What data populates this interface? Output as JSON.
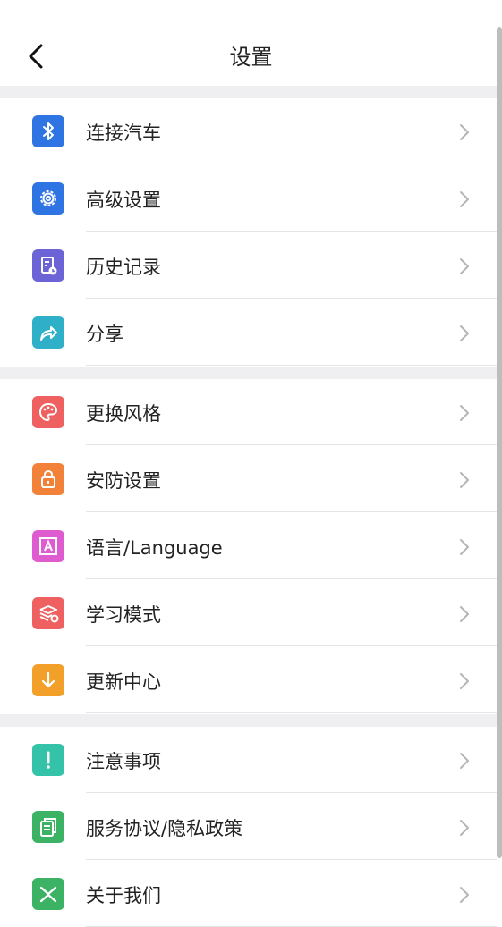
{
  "header": {
    "title": "设置"
  },
  "colors": {
    "background": "#ffffff",
    "separator": "#efeff2",
    "divider": "#e4e4e4",
    "chevron": "#b5b5b5"
  },
  "groups": [
    {
      "items": [
        {
          "label": "连接汽车",
          "icon": "bluetooth-icon",
          "color": "#2f74e3"
        },
        {
          "label": "高级设置",
          "icon": "gear-icon",
          "color": "#2f74e3"
        },
        {
          "label": "历史记录",
          "icon": "history-record-icon",
          "color": "#6b63d6"
        },
        {
          "label": "分享",
          "icon": "share-icon",
          "color": "#2fb0c9"
        }
      ]
    },
    {
      "items": [
        {
          "label": "更换风格",
          "icon": "palette-icon",
          "color": "#ee6160"
        },
        {
          "label": "安防设置",
          "icon": "lock-icon",
          "color": "#f2813a"
        },
        {
          "label": "语言/Language",
          "icon": "language-icon",
          "color": "#df5cd0"
        },
        {
          "label": "学习模式",
          "icon": "learning-layers-icon",
          "color": "#ee6160"
        },
        {
          "label": "更新中心",
          "icon": "download-arrow-icon",
          "color": "#f3a02b"
        }
      ]
    },
    {
      "items": [
        {
          "label": "注意事项",
          "icon": "exclamation-icon",
          "color": "#34c3a9"
        },
        {
          "label": "服务协议/隐私政策",
          "icon": "document-icon",
          "color": "#3bb264"
        },
        {
          "label": "关于我们",
          "icon": "about-us-icon",
          "color": "#3bb264"
        }
      ]
    }
  ]
}
